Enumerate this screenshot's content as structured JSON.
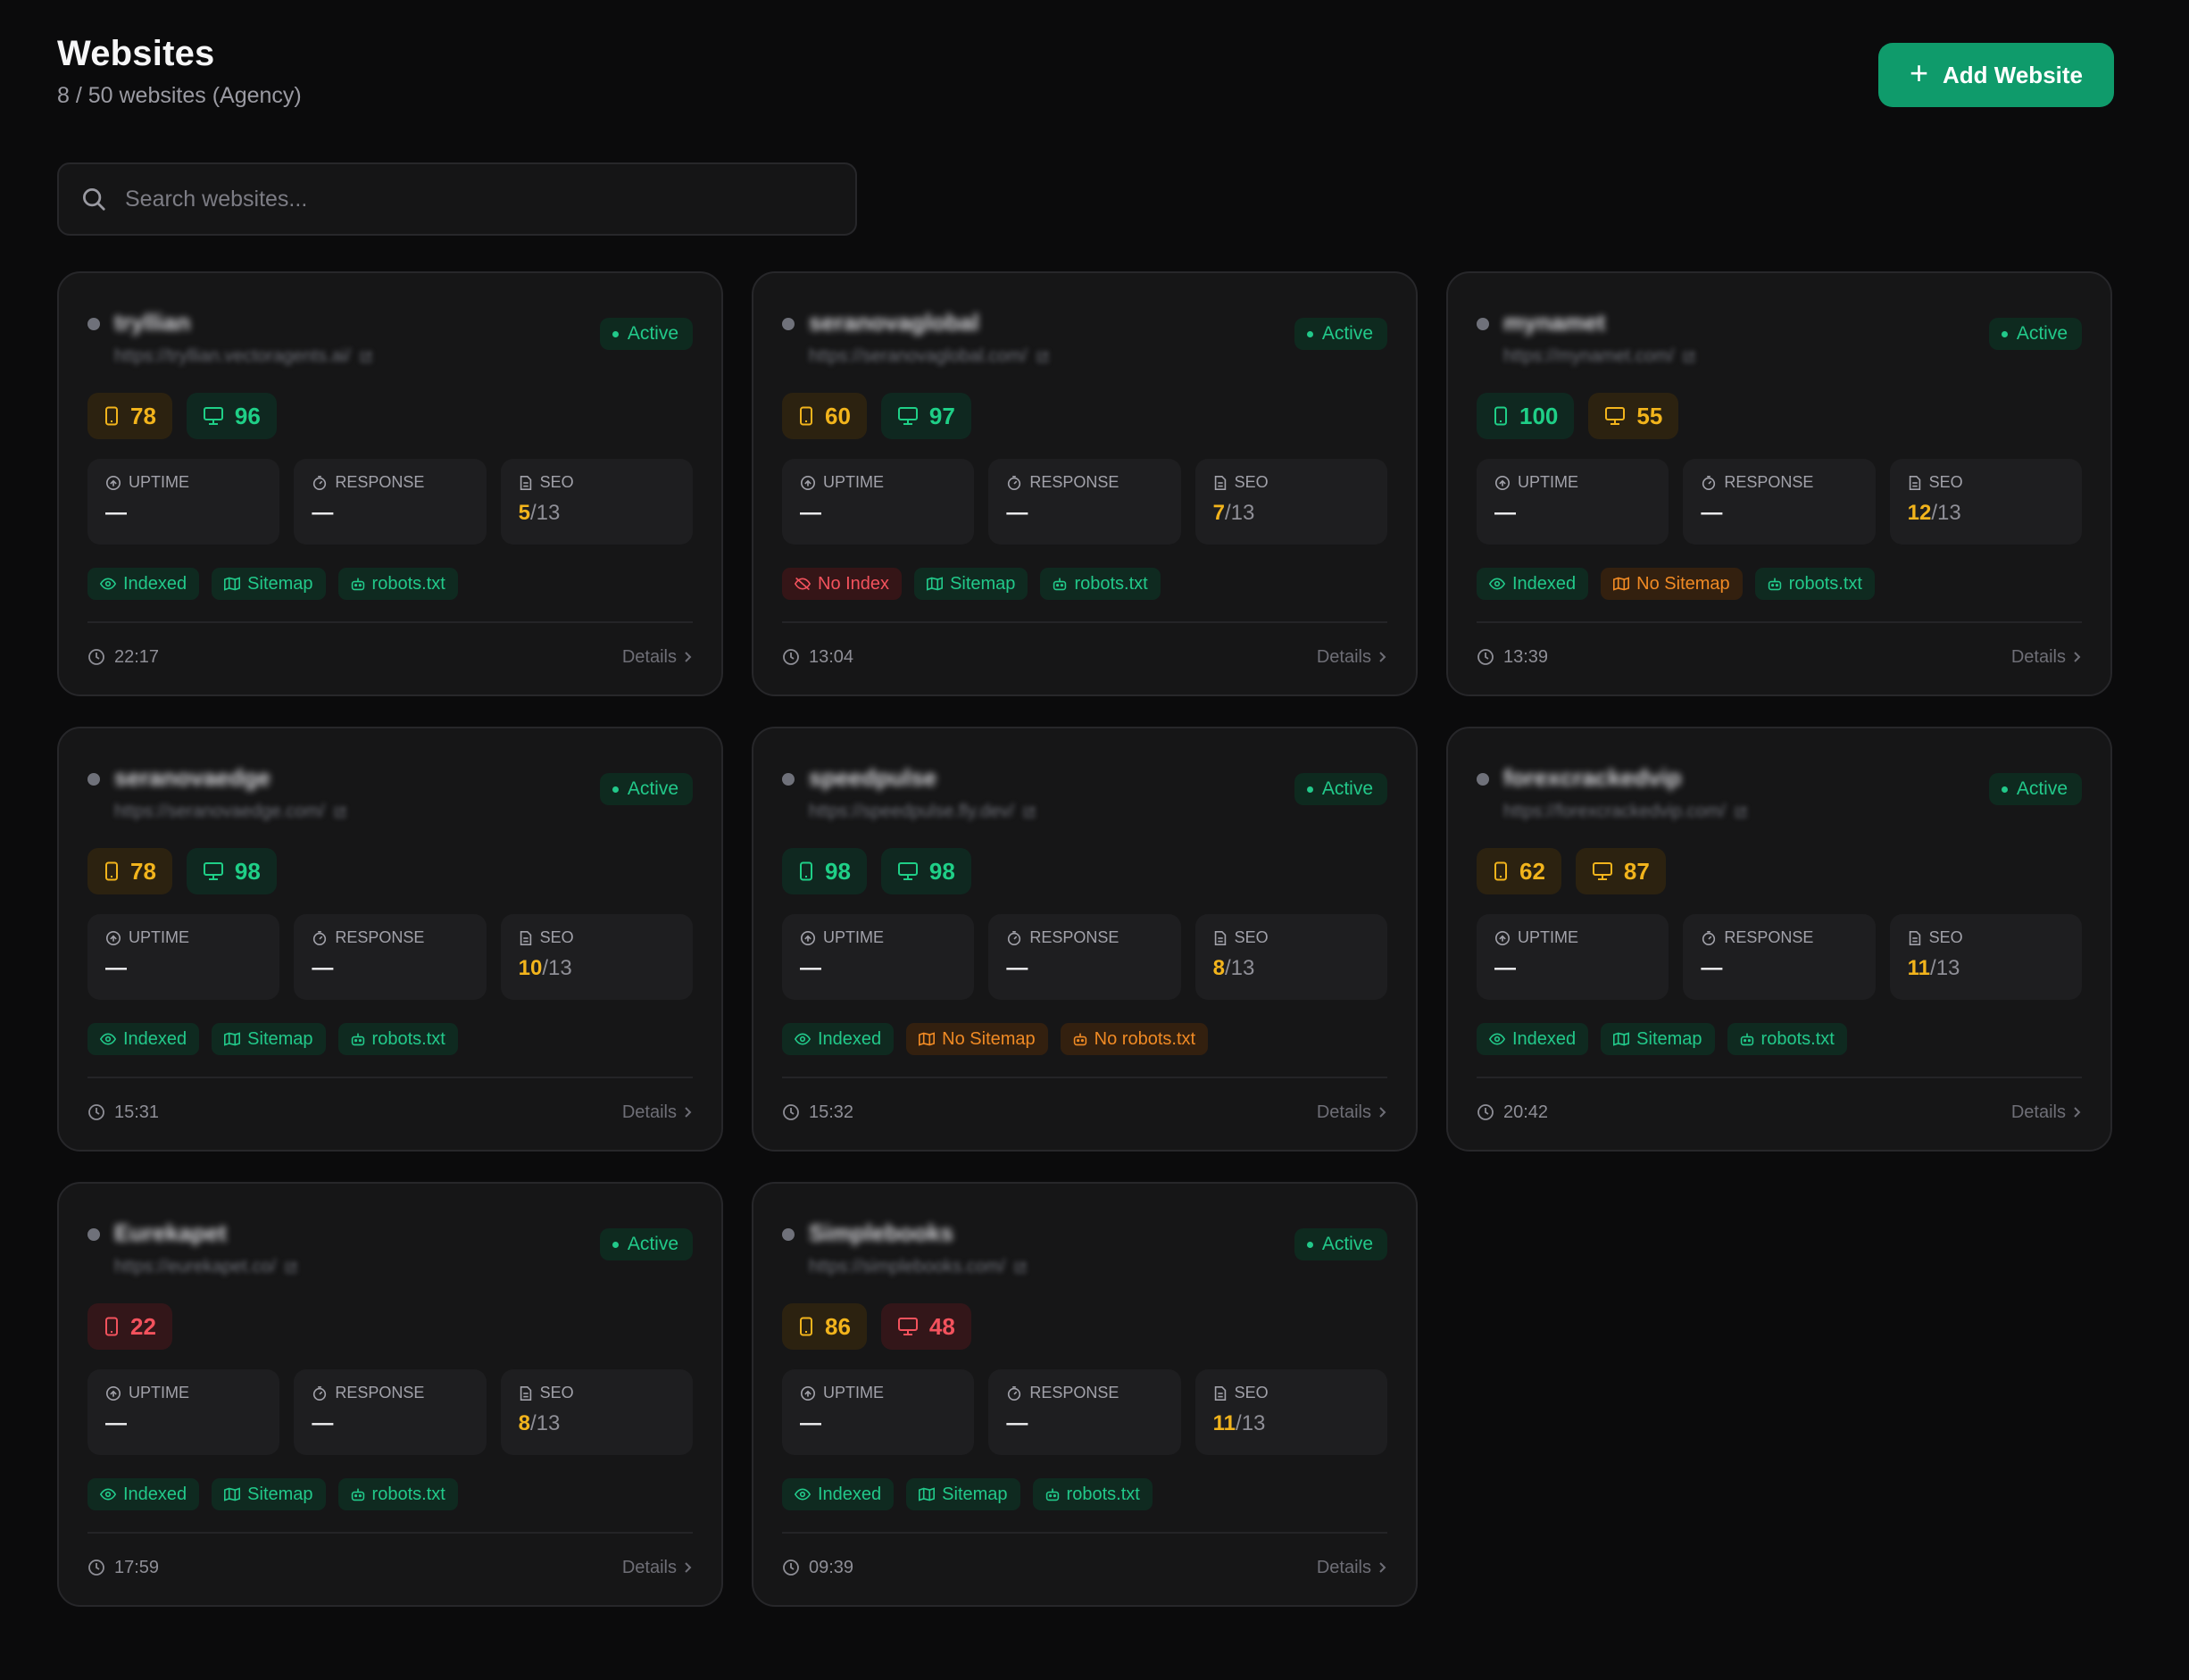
{
  "header": {
    "title": "Websites",
    "subtitle": "8 / 50 websites (Agency)",
    "add_button_label": "Add Website"
  },
  "search": {
    "placeholder": "Search websites..."
  },
  "labels": {
    "uptime": "UPTIME",
    "response": "RESPONSE",
    "seo": "SEO",
    "details": "Details"
  },
  "colors": {
    "accent": "#0f9b6b",
    "good": "#1fcf87",
    "mid": "#f2b41c",
    "bad": "#f3525d",
    "warn": "#f08a24"
  },
  "websites": [
    {
      "name": "tryllian",
      "url": "https://tryllian.vectoragents.ai/",
      "status": "Active",
      "scores": [
        {
          "device": "mobile",
          "value": "78",
          "level": "mid"
        },
        {
          "device": "desktop",
          "value": "96",
          "level": "good"
        }
      ],
      "uptime": "—",
      "response": "—",
      "seo_score": "5",
      "seo_total": "/13",
      "tags": [
        {
          "icon": "eye",
          "label": "Indexed",
          "state": "ok"
        },
        {
          "icon": "map",
          "label": "Sitemap",
          "state": "ok"
        },
        {
          "icon": "bot",
          "label": "robots.txt",
          "state": "ok"
        }
      ],
      "time": "22:17"
    },
    {
      "name": "seranovaglobal",
      "url": "https://seranovaglobal.com/",
      "status": "Active",
      "scores": [
        {
          "device": "mobile",
          "value": "60",
          "level": "mid"
        },
        {
          "device": "desktop",
          "value": "97",
          "level": "good"
        }
      ],
      "uptime": "—",
      "response": "—",
      "seo_score": "7",
      "seo_total": "/13",
      "tags": [
        {
          "icon": "eye-off",
          "label": "No Index",
          "state": "err"
        },
        {
          "icon": "map",
          "label": "Sitemap",
          "state": "ok"
        },
        {
          "icon": "bot",
          "label": "robots.txt",
          "state": "ok"
        }
      ],
      "time": "13:04"
    },
    {
      "name": "mynamet",
      "url": "https://mynamet.com/",
      "status": "Active",
      "scores": [
        {
          "device": "mobile",
          "value": "100",
          "level": "good"
        },
        {
          "device": "desktop",
          "value": "55",
          "level": "mid"
        }
      ],
      "uptime": "—",
      "response": "—",
      "seo_score": "12",
      "seo_total": "/13",
      "tags": [
        {
          "icon": "eye",
          "label": "Indexed",
          "state": "ok"
        },
        {
          "icon": "map",
          "label": "No Sitemap",
          "state": "warn"
        },
        {
          "icon": "bot",
          "label": "robots.txt",
          "state": "ok"
        }
      ],
      "time": "13:39"
    },
    {
      "name": "seranovaedge",
      "url": "https://seranovaedge.com/",
      "status": "Active",
      "scores": [
        {
          "device": "mobile",
          "value": "78",
          "level": "mid"
        },
        {
          "device": "desktop",
          "value": "98",
          "level": "good"
        }
      ],
      "uptime": "—",
      "response": "—",
      "seo_score": "10",
      "seo_total": "/13",
      "tags": [
        {
          "icon": "eye",
          "label": "Indexed",
          "state": "ok"
        },
        {
          "icon": "map",
          "label": "Sitemap",
          "state": "ok"
        },
        {
          "icon": "bot",
          "label": "robots.txt",
          "state": "ok"
        }
      ],
      "time": "15:31"
    },
    {
      "name": "speedpulse",
      "url": "https://speedpulse.fly.dev/",
      "status": "Active",
      "scores": [
        {
          "device": "mobile",
          "value": "98",
          "level": "good"
        },
        {
          "device": "desktop",
          "value": "98",
          "level": "good"
        }
      ],
      "uptime": "—",
      "response": "—",
      "seo_score": "8",
      "seo_total": "/13",
      "tags": [
        {
          "icon": "eye",
          "label": "Indexed",
          "state": "ok"
        },
        {
          "icon": "map",
          "label": "No Sitemap",
          "state": "warn"
        },
        {
          "icon": "bot",
          "label": "No robots.txt",
          "state": "warn"
        }
      ],
      "time": "15:32"
    },
    {
      "name": "forexcrackedvip",
      "url": "https://forexcrackedvip.com/",
      "status": "Active",
      "scores": [
        {
          "device": "mobile",
          "value": "62",
          "level": "mid"
        },
        {
          "device": "desktop",
          "value": "87",
          "level": "mid"
        }
      ],
      "uptime": "—",
      "response": "—",
      "seo_score": "11",
      "seo_total": "/13",
      "tags": [
        {
          "icon": "eye",
          "label": "Indexed",
          "state": "ok"
        },
        {
          "icon": "map",
          "label": "Sitemap",
          "state": "ok"
        },
        {
          "icon": "bot",
          "label": "robots.txt",
          "state": "ok"
        }
      ],
      "time": "20:42"
    },
    {
      "name": "Eurekapet",
      "url": "https://eurekapet.co/",
      "status": "Active",
      "scores": [
        {
          "device": "mobile",
          "value": "22",
          "level": "bad"
        }
      ],
      "uptime": "—",
      "response": "—",
      "seo_score": "8",
      "seo_total": "/13",
      "tags": [
        {
          "icon": "eye",
          "label": "Indexed",
          "state": "ok"
        },
        {
          "icon": "map",
          "label": "Sitemap",
          "state": "ok"
        },
        {
          "icon": "bot",
          "label": "robots.txt",
          "state": "ok"
        }
      ],
      "time": "17:59"
    },
    {
      "name": "Simplebooks",
      "url": "https://simplebooks.com/",
      "status": "Active",
      "scores": [
        {
          "device": "mobile",
          "value": "86",
          "level": "mid"
        },
        {
          "device": "desktop",
          "value": "48",
          "level": "bad"
        }
      ],
      "uptime": "—",
      "response": "—",
      "seo_score": "11",
      "seo_total": "/13",
      "tags": [
        {
          "icon": "eye",
          "label": "Indexed",
          "state": "ok"
        },
        {
          "icon": "map",
          "label": "Sitemap",
          "state": "ok"
        },
        {
          "icon": "bot",
          "label": "robots.txt",
          "state": "ok"
        }
      ],
      "time": "09:39"
    }
  ]
}
